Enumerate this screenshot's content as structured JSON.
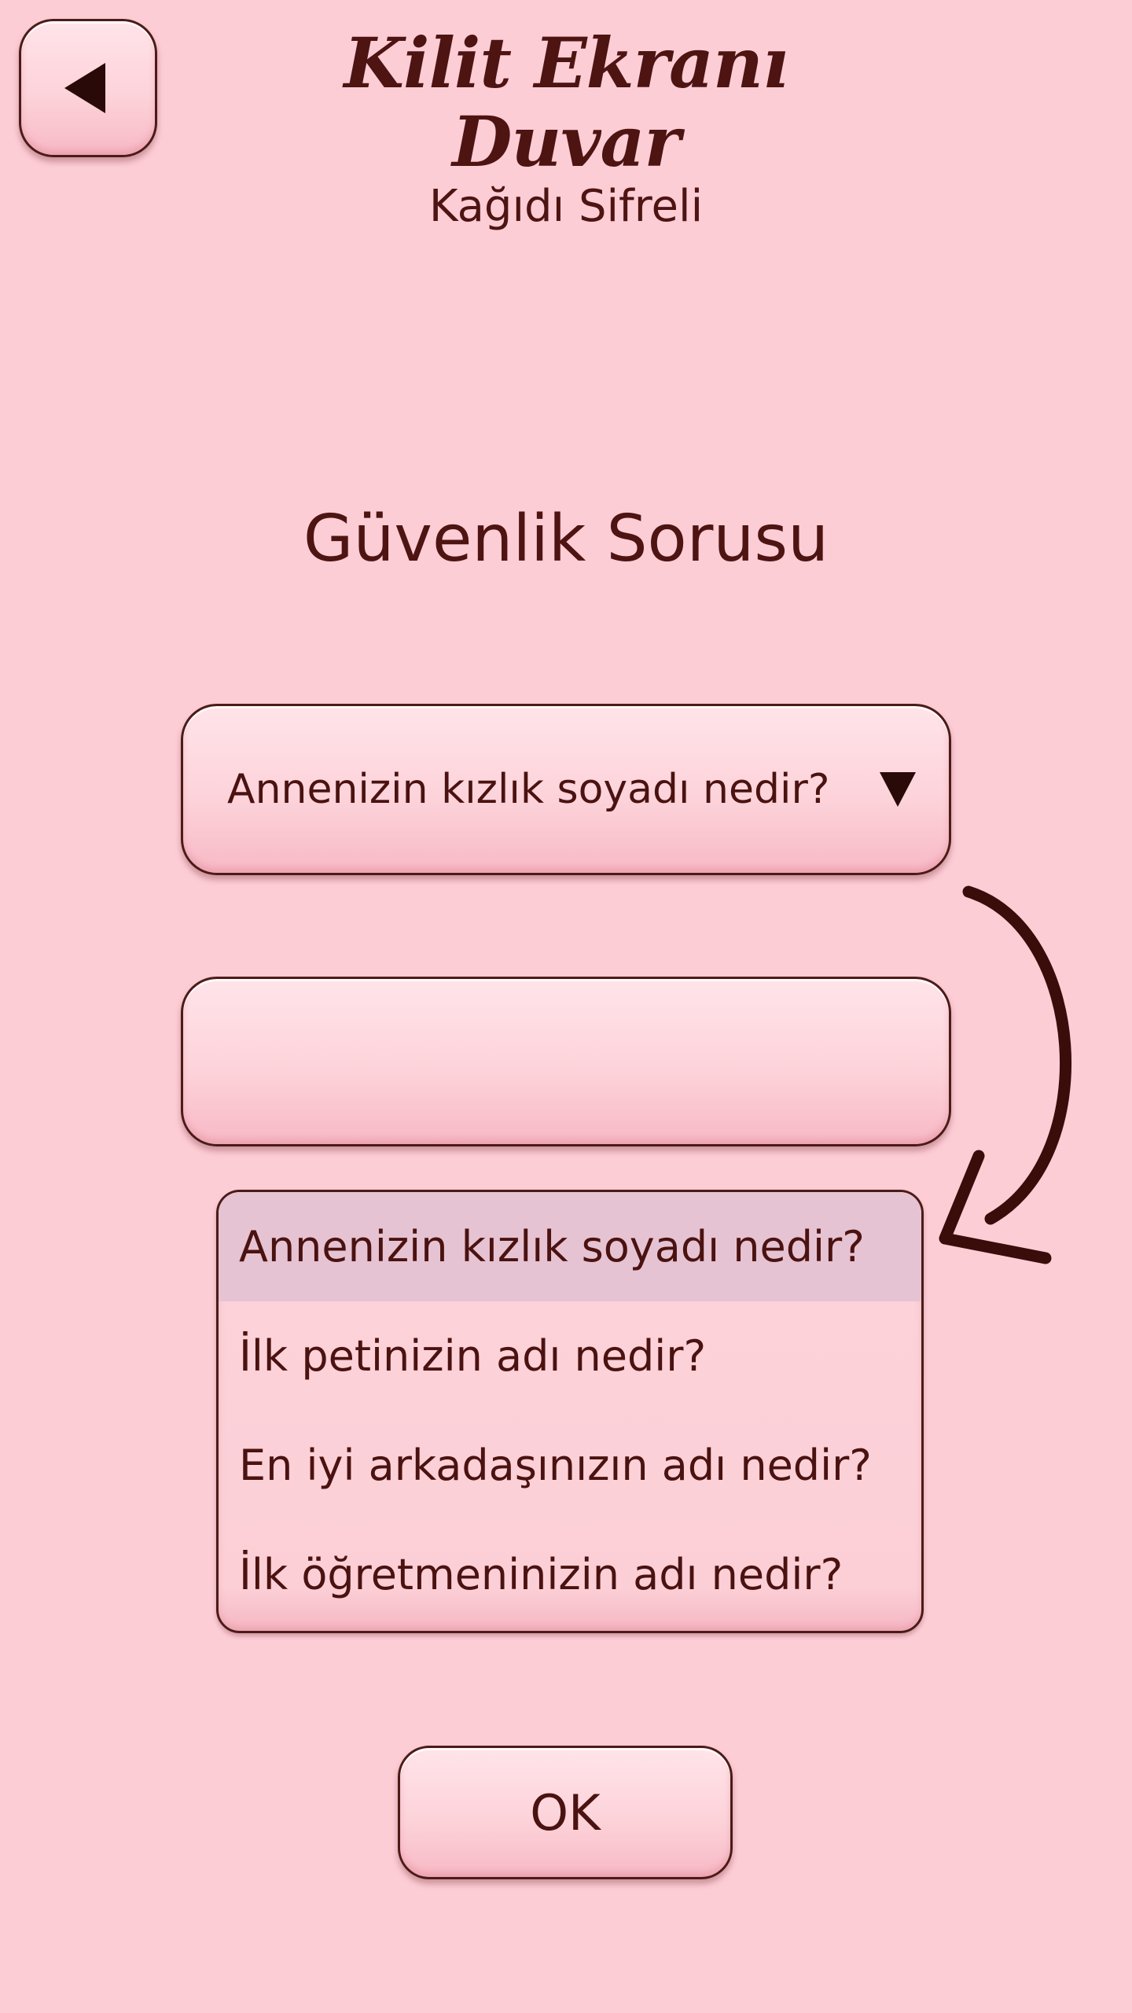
{
  "header": {
    "title_line1": "Kilit Ekranı Duvar",
    "title_line2": "Kağıdı Sifreli"
  },
  "section_title": "Güvenlik Sorusu",
  "question_select": {
    "selected_value": "Annenizin kızlık soyadı nedir?"
  },
  "answer_input": {
    "value": "",
    "placeholder": ""
  },
  "options": [
    {
      "label": "Annenizin kızlık soyadı nedir?"
    },
    {
      "label": "İlk petinizin adı nedir?"
    },
    {
      "label": "En iyi arkadaşınızın adı nedir?"
    },
    {
      "label": "İlk öğretmeninizin adı nedir?"
    }
  ],
  "ok_button": {
    "label": "OK"
  },
  "icons": {
    "back": "back-arrow-icon",
    "dropdown": "dropdown-arrow-icon",
    "hint": "curved-arrow-icon"
  },
  "colors": {
    "background": "#fdcdd6",
    "text": "#4a1210",
    "selected_option": "#e6c3d2"
  }
}
